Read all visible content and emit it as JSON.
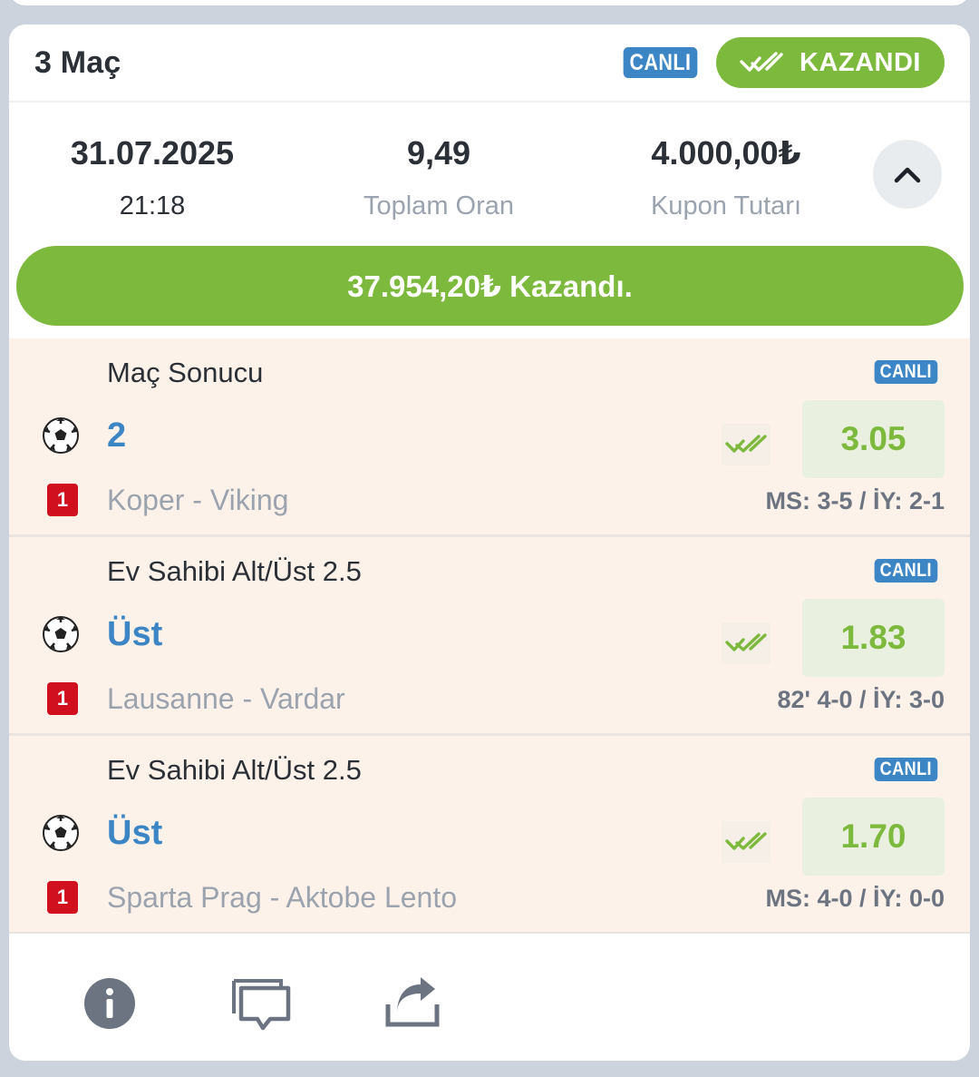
{
  "coupon": {
    "title": "3 Maç",
    "live_badge": "CANLI",
    "status_label": "KAZANDI",
    "date": "31.07.2025",
    "time": "21:18",
    "total_odds": "9,49",
    "total_odds_label": "Toplam Oran",
    "stake": "4.000,00₺",
    "stake_label": "Kupon Tutarı",
    "win_text": "37.954,20₺ Kazandı."
  },
  "bets": [
    {
      "market": "Maç Sonucu",
      "live_badge": "CANLI",
      "pick": "2",
      "odds": "3.05",
      "live_number": "1",
      "teams": "Koper - Viking",
      "score": "MS: 3-5 / İY: 2-1"
    },
    {
      "market": "Ev Sahibi Alt/Üst 2.5",
      "live_badge": "CANLI",
      "pick": "Üst",
      "odds": "1.83",
      "live_number": "1",
      "teams": "Lausanne - Vardar",
      "score": "82' 4-0 / İY: 3-0"
    },
    {
      "market": "Ev Sahibi Alt/Üst 2.5",
      "live_badge": "CANLI",
      "pick": "Üst",
      "odds": "1.70",
      "live_number": "1",
      "teams": "Sparta Prag - Aktobe Lento",
      "score": "MS: 4-0 / İY: 0-0"
    }
  ],
  "footer": {
    "icons": [
      "info-icon",
      "chat-icon",
      "share-icon"
    ]
  },
  "colors": {
    "accent_green": "#7cb93d",
    "live_blue": "#3d86c6",
    "live_red": "#d0101e",
    "bet_bg": "#fdf2ea"
  }
}
